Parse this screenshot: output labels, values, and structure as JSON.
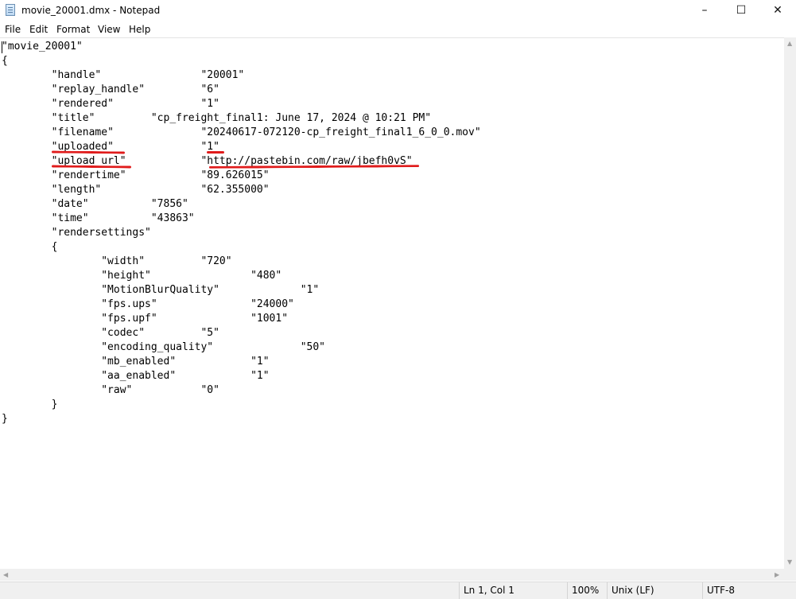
{
  "window": {
    "title": "movie_20001.dmx - Notepad",
    "controls": {
      "minimize": "–",
      "maximize": "☐",
      "close": "✕"
    }
  },
  "menu": [
    "File",
    "Edit",
    "Format",
    "View",
    "Help"
  ],
  "document": {
    "text": "\"movie_20001\"\n{\n\t\"handle\"\t\t\"20001\"\n\t\"replay_handle\"\t\t\"6\"\n\t\"rendered\"\t\t\"1\"\n\t\"title\"\t\t\"cp_freight_final1: June 17, 2024 @ 10:21 PM\"\n\t\"filename\"\t\t\"20240617-072120-cp_freight_final1_6_0_0.mov\"\n\t\"uploaded\"\t\t\"1\"\n\t\"upload_url\"\t\t\"http://pastebin.com/raw/jbefh0vS\"\n\t\"rendertime\"\t\t\"89.626015\"\n\t\"length\"\t\t\"62.355000\"\n\t\"date\"\t\t\"7856\"\n\t\"time\"\t\t\"43863\"\n\t\"rendersettings\"\n\t{\n\t\t\"width\"\t\t\"720\"\n\t\t\"height\"\t\t\"480\"\n\t\t\"MotionBlurQuality\"\t\t\"1\"\n\t\t\"fps.ups\"\t\t\"24000\"\n\t\t\"fps.upf\"\t\t\"1001\"\n\t\t\"codec\"\t\t\"5\"\n\t\t\"encoding_quality\"\t\t\"50\"\n\t\t\"mb_enabled\"\t\t\"1\"\n\t\t\"aa_enabled\"\t\t\"1\"\n\t\t\"raw\"\t\t\"0\"\n\t}\n}"
  },
  "status": {
    "position": "Ln 1, Col 1",
    "zoom": "100%",
    "line_ending": "Unix (LF)",
    "encoding": "UTF-8"
  },
  "annotation_color": "#e01b1b"
}
